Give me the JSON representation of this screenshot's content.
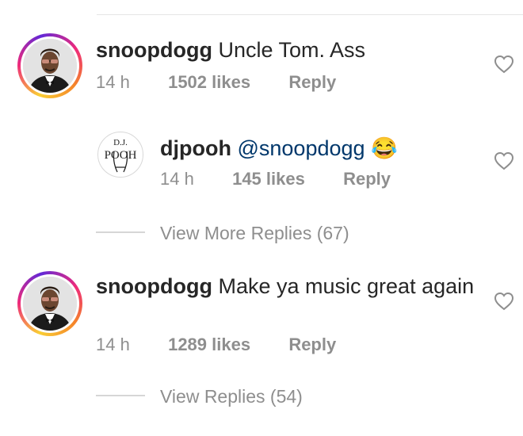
{
  "comments": [
    {
      "username": "snoopdogg",
      "text": "Uncle Tom. Ass",
      "time": "14 h",
      "likes": "1502 likes",
      "reply": "Reply",
      "reply_thread": {
        "username": "djpooh",
        "mention": "@snoopdogg",
        "emoji": "😂",
        "time": "14 h",
        "likes": "145 likes",
        "reply": "Reply",
        "avatar_text": "D.J. POOH"
      },
      "view_more": "View More Replies (67)"
    },
    {
      "username": "snoopdogg",
      "text": "Make ya music great again",
      "time": "14 h",
      "likes": "1289 likes",
      "reply": "Reply",
      "view_more": "View Replies (54)"
    }
  ],
  "colors": {
    "text": "#262626",
    "secondary": "#8e8e8e",
    "mention": "#00376b",
    "divider": "#d6d6d6"
  }
}
